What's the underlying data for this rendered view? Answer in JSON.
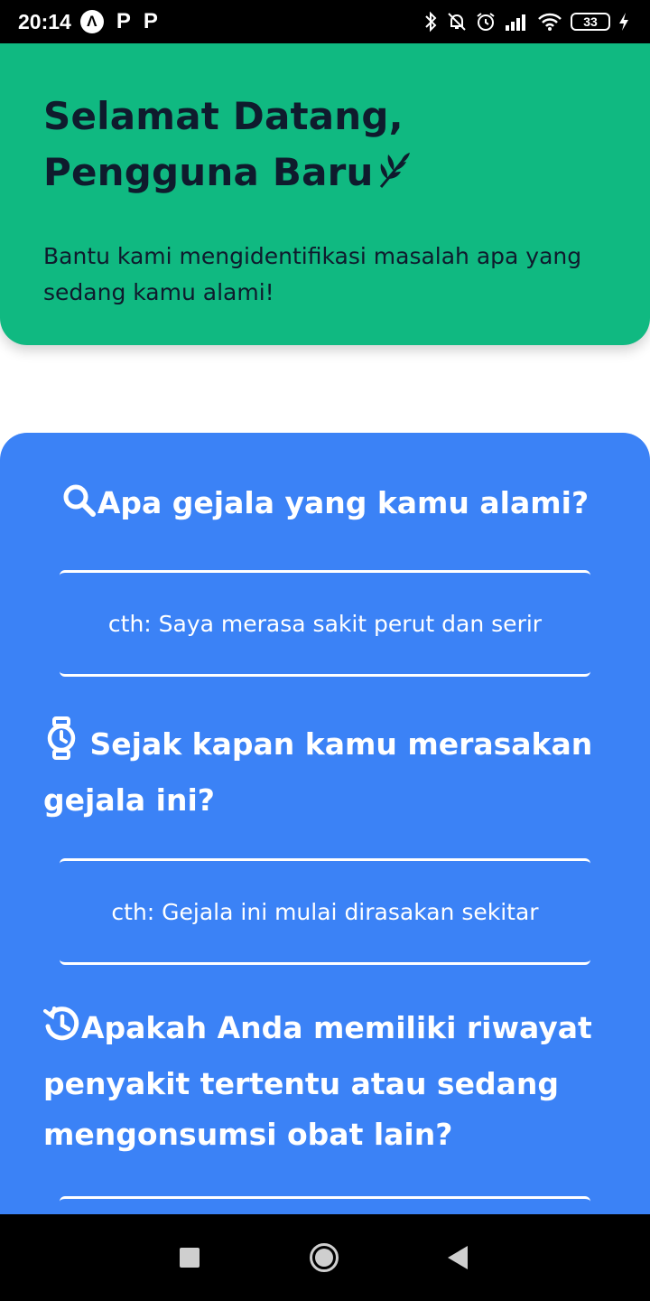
{
  "status_bar": {
    "time": "20:14",
    "notif_badge": "Λ",
    "notif_p1": "P",
    "notif_p2": "P",
    "battery": "33"
  },
  "welcome": {
    "title_line1": "Selamat Datang,",
    "title_line2": "Pengguna Baru",
    "title_icon": "leaf-icon",
    "subtitle": "Bantu kami mengidentifikasi masalah apa yang sedang kamu alami!",
    "bg_color": "#10b981"
  },
  "form": {
    "bg_color": "#3b82f6",
    "questions": [
      {
        "icon": "search-icon",
        "label": "Apa gejala yang kamu alami?",
        "placeholder": "cth: Saya merasa sakit perut dan serir"
      },
      {
        "icon": "watch-icon",
        "label": "Sejak kapan kamu merasakan gejala ini?",
        "placeholder": "cth: Gejala ini mulai dirasakan sekitar"
      },
      {
        "icon": "history-icon",
        "label": "Apakah Anda memiliki riwayat penyakit tertentu atau sedang mengonsumsi obat lain?",
        "placeholder": ""
      }
    ]
  },
  "nav_bar": {
    "icons": [
      "recent-apps-icon",
      "home-icon",
      "back-icon"
    ]
  }
}
